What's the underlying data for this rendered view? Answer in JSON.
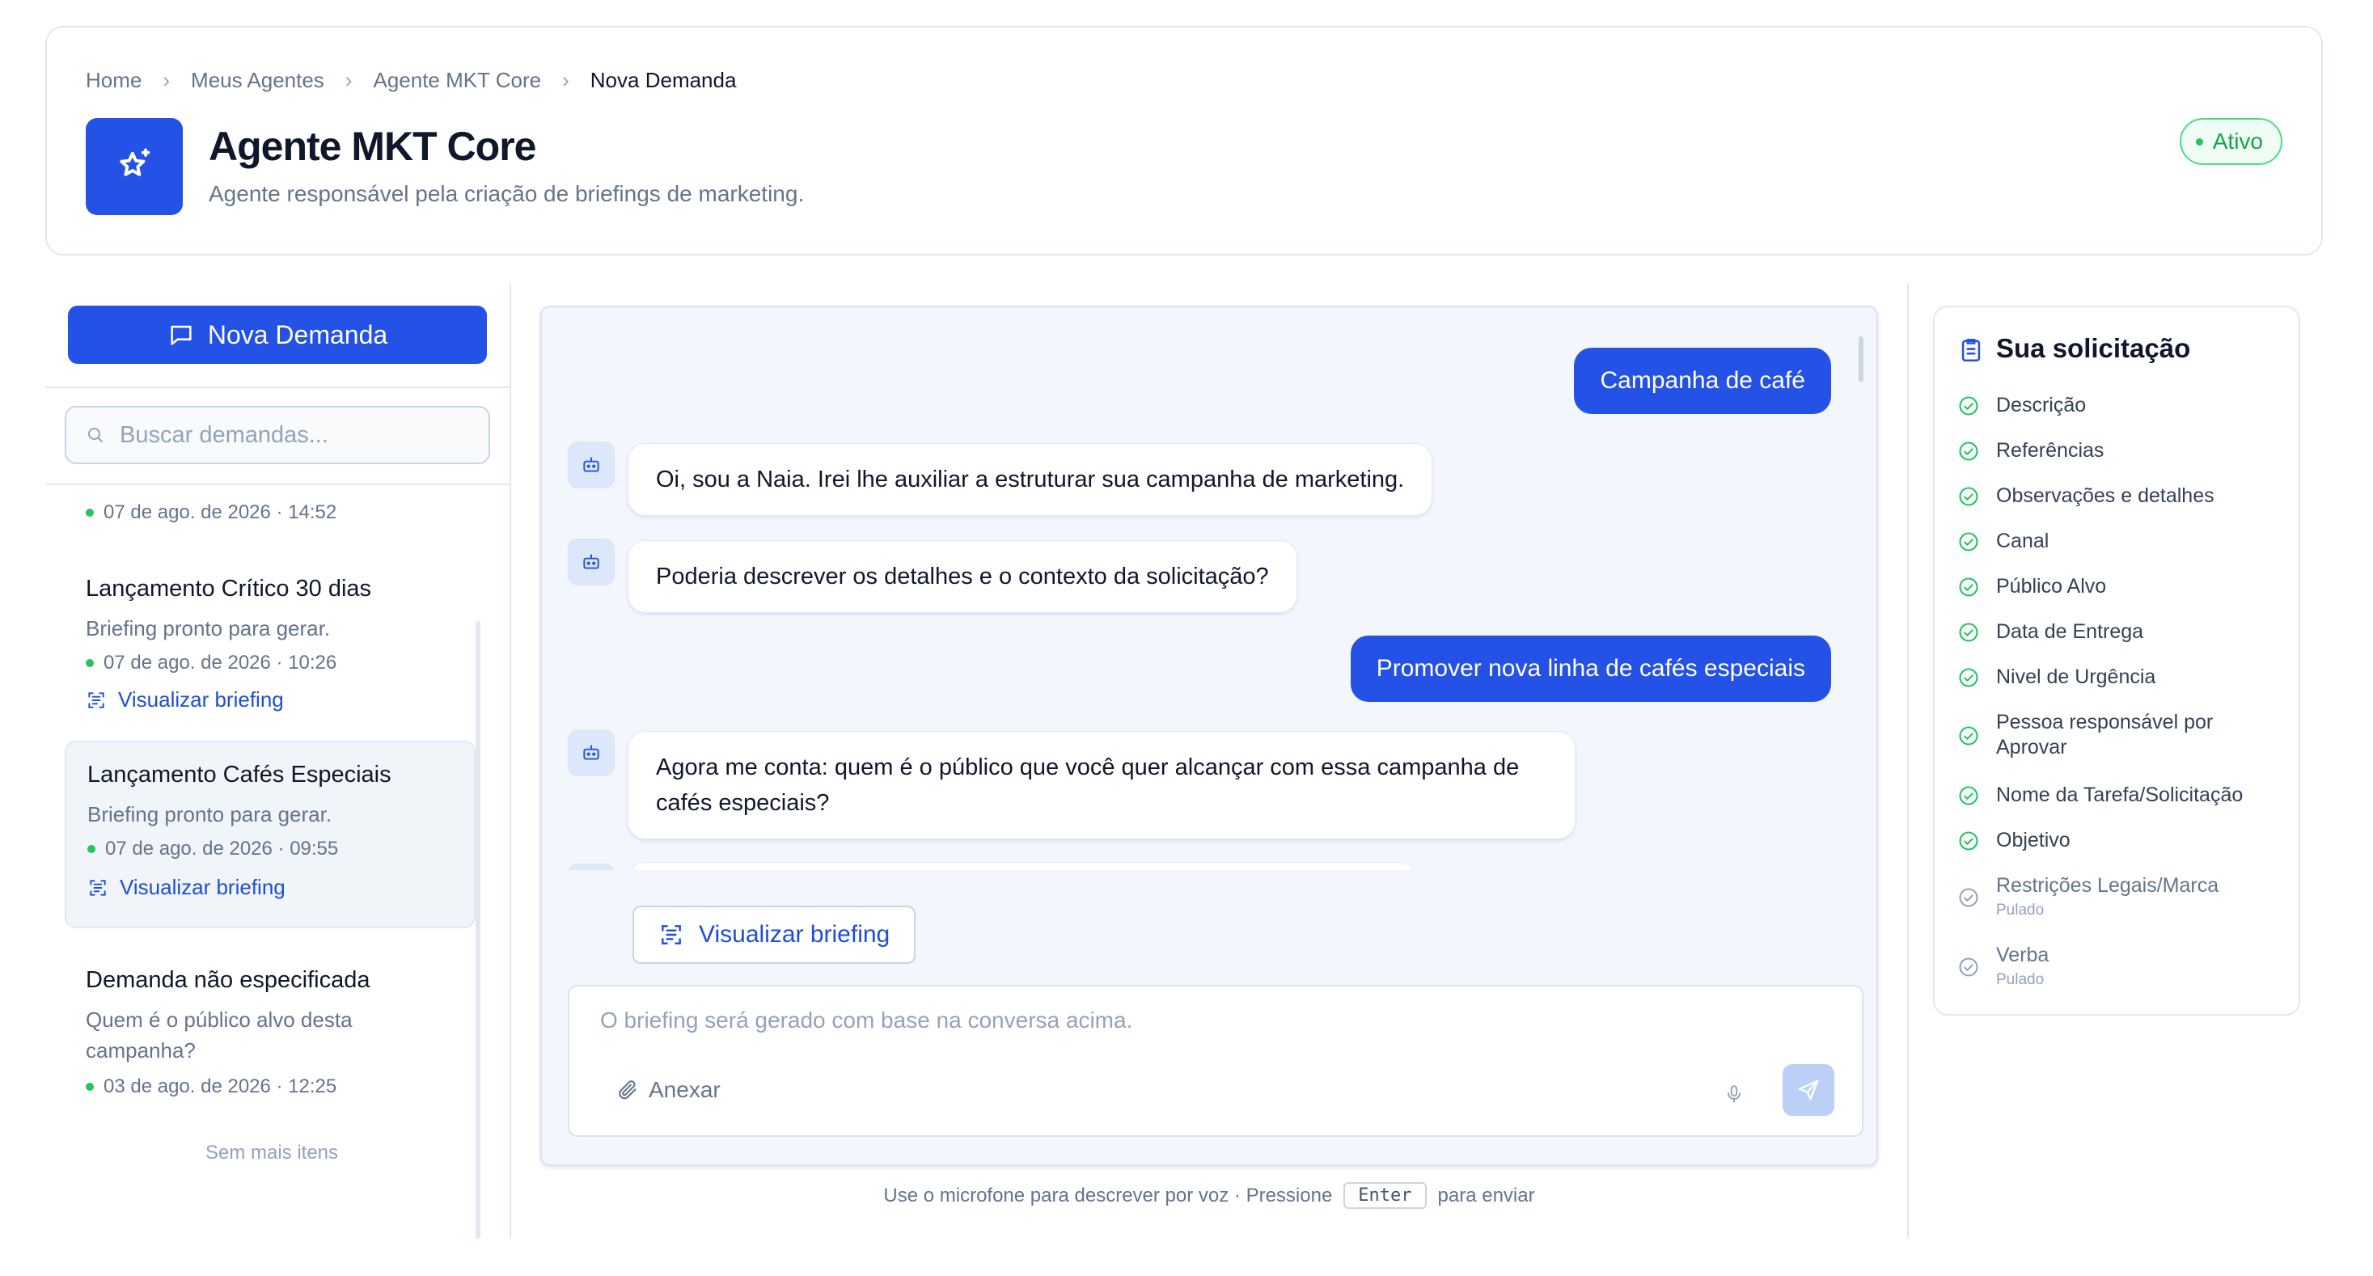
{
  "breadcrumb": {
    "items": [
      "Home",
      "Meus Agentes",
      "Agente MKT Core",
      "Nova Demanda"
    ],
    "separator": ">"
  },
  "agent": {
    "title": "Agente MKT Core",
    "subtitle": "Agente responsável pela criação de briefings de marketing.",
    "icon": "sparkle-star-icon",
    "status": "Ativo"
  },
  "sidebar": {
    "new_button": "Nova Demanda",
    "search_placeholder": "Buscar demandas...",
    "partial_item_date": "07 de ago. de 2026 · 14:52",
    "items": [
      {
        "title": "Lançamento Crítico 30 dias",
        "desc": "Briefing pronto para gerar.",
        "date": "07 de ago. de 2026 · 10:26",
        "link": "Visualizar briefing"
      },
      {
        "title": "Lançamento Cafés Especiais",
        "desc": "Briefing pronto para gerar.",
        "date": "07 de ago. de 2026 · 09:55",
        "link": "Visualizar briefing",
        "selected": true
      },
      {
        "title": "Demanda não especificada",
        "desc": "Quem é o público alvo desta campanha?",
        "date": "03 de ago. de 2026 · 12:25"
      }
    ],
    "end_text": "Sem mais itens"
  },
  "chat": {
    "messages": [
      {
        "role": "user",
        "text": "Campanha de café"
      },
      {
        "role": "bot",
        "text": "Oi, sou a Naia. Irei lhe auxiliar a estruturar sua campanha de marketing."
      },
      {
        "role": "bot",
        "text": "Poderia descrever os detalhes e o contexto da solicitação?"
      },
      {
        "role": "user",
        "text": "Promover nova linha de cafés especiais"
      },
      {
        "role": "bot",
        "text": "Agora me conta: quem é o público que você quer alcançar com essa campanha de cafés especiais?"
      }
    ],
    "view_briefing_button": "Visualizar briefing",
    "composer_placeholder": "O briefing será gerado com base na conversa acima.",
    "attach_label": "Anexar",
    "hint_before": "Use o microfone para descrever por voz · Pressione",
    "hint_key": "Enter",
    "hint_after": "para enviar"
  },
  "request": {
    "title": "Sua solicitação",
    "items": [
      {
        "label": "Descrição",
        "state": "done"
      },
      {
        "label": "Referências",
        "state": "done"
      },
      {
        "label": "Observações e detalhes",
        "state": "done"
      },
      {
        "label": "Canal",
        "state": "done"
      },
      {
        "label": "Público Alvo",
        "state": "done"
      },
      {
        "label": "Data de Entrega",
        "state": "done"
      },
      {
        "label": "Nivel de Urgência",
        "state": "done"
      },
      {
        "label": "Pessoa responsável por Aprovar",
        "state": "done"
      },
      {
        "label": "Nome da Tarefa/Solicitação",
        "state": "done"
      },
      {
        "label": "Objetivo",
        "state": "done"
      },
      {
        "label": "Restrições Legais/Marca",
        "state": "skipped",
        "sub": "Pulado"
      },
      {
        "label": "Verba",
        "state": "skipped",
        "sub": "Pulado"
      }
    ]
  },
  "colors": {
    "primary": "#2451e6",
    "success": "#22c55e",
    "chat_bg": "#f3f7fd",
    "link": "#1d4ed8"
  }
}
